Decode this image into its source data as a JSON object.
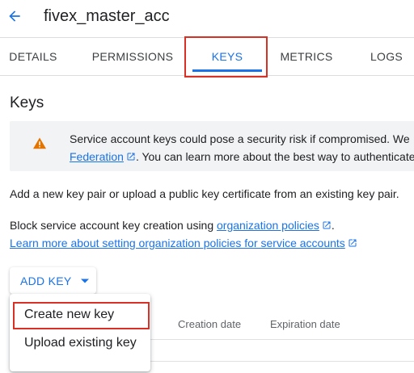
{
  "header": {
    "title": "fivex_master_acc",
    "back_icon": "arrow-back-icon"
  },
  "tabs": [
    {
      "label": "DETAILS"
    },
    {
      "label": "PERMISSIONS"
    },
    {
      "label": "KEYS",
      "active": true
    },
    {
      "label": "METRICS"
    },
    {
      "label": "LOGS"
    }
  ],
  "section": {
    "title": "Keys"
  },
  "warning": {
    "line1": "Service account keys could pose a security risk if compromised. We",
    "federation_link": "Federation",
    "line2_rest": ". You can learn more about the best way to authenticate"
  },
  "intro": {
    "text": "Add a new key pair or upload a public key certificate from an existing key pair."
  },
  "policy": {
    "text_prefix": "Block service account key creation using ",
    "link1": "organization policies",
    "link1_suffix": ".",
    "link2": "Learn more about setting organization policies for service accounts"
  },
  "add_key": {
    "label": "ADD KEY"
  },
  "table": {
    "headers": {
      "creation_date": "Creation date",
      "expiration_date": "Expiration date"
    }
  },
  "menu": {
    "items": [
      {
        "label": "Create new key",
        "highlighted": true
      },
      {
        "label": "Upload existing key"
      }
    ]
  },
  "colors": {
    "accent": "#1a73e8",
    "warning": "#e37400",
    "highlight_border": "#d93025"
  }
}
